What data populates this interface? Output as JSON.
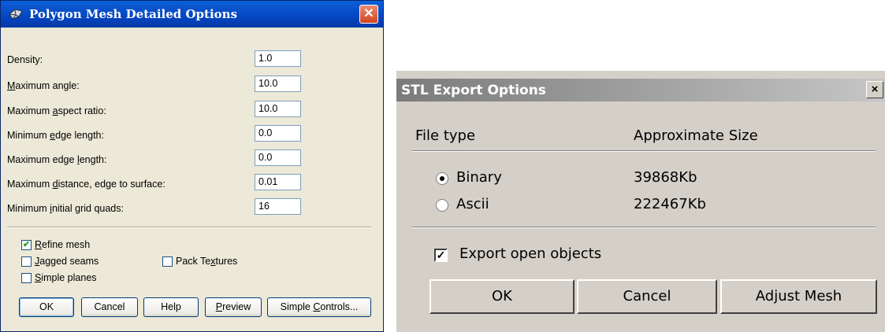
{
  "polygon_mesh": {
    "title": "Polygon Mesh Detailed Options",
    "fields": [
      {
        "label_pre": "Density:",
        "label_u": "",
        "label_post": "",
        "value": "1.0"
      },
      {
        "label_pre": "",
        "label_u": "M",
        "label_post": "aximum angle:",
        "value": "10.0"
      },
      {
        "label_pre": "Maximum ",
        "label_u": "a",
        "label_post": "spect ratio:",
        "value": "10.0"
      },
      {
        "label_pre": "Minimum ",
        "label_u": "e",
        "label_post": "dge length:",
        "value": "0.0"
      },
      {
        "label_pre": "Maximum edge ",
        "label_u": "l",
        "label_post": "ength:",
        "value": "0.0"
      },
      {
        "label_pre": "Maximum ",
        "label_u": "d",
        "label_post": "istance, edge to surface:",
        "value": "0.01"
      },
      {
        "label_pre": "Minimum ",
        "label_u": "i",
        "label_post": "nitial grid quads:",
        "value": "16"
      }
    ],
    "checkboxes": {
      "refine_mesh": {
        "u": "R",
        "rest": "efine mesh",
        "checked": true
      },
      "jagged_seams": {
        "u": "J",
        "rest": "agged seams",
        "checked": false
      },
      "simple_planes": {
        "u": "S",
        "rest": "imple planes",
        "checked": false
      },
      "pack_textures": {
        "pre": "Pack Te",
        "u": "x",
        "rest": "tures",
        "checked": false
      }
    },
    "buttons": {
      "ok": "OK",
      "cancel": "Cancel",
      "help": "Help",
      "preview_u": "P",
      "preview_rest": "review",
      "simple_pre": "Simple ",
      "simple_u": "C",
      "simple_rest": "ontrols..."
    }
  },
  "stl_export": {
    "title": "STL Export Options",
    "close": "×",
    "file_type_header": "File type",
    "size_header": "Approximate Size",
    "options": [
      {
        "label": "Binary",
        "size": "39868Kb",
        "selected": true
      },
      {
        "label": "Ascii",
        "size": "222467Kb",
        "selected": false
      }
    ],
    "export_open_objects": {
      "label": "Export open objects",
      "checked": true
    },
    "buttons": {
      "ok": "OK",
      "cancel": "Cancel",
      "adjust": "Adjust Mesh"
    }
  }
}
